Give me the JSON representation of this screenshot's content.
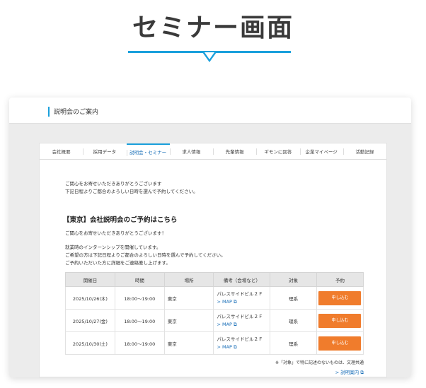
{
  "hero": {
    "title": "セミナー画面"
  },
  "window": {
    "title": "説明会のご案内"
  },
  "tabs": [
    {
      "label": "会社概要"
    },
    {
      "label": "採用データ"
    },
    {
      "label": "説明会・セミナー"
    },
    {
      "label": "求人情報"
    },
    {
      "label": "先輩情報"
    },
    {
      "label": "ギモンに回答"
    },
    {
      "label": "企業マイページ"
    },
    {
      "label": "活動記録"
    }
  ],
  "intro": {
    "line1": "ご関心をお寄せいただきありがとうございます",
    "line2": "下記日程よりご都合のよろしい日時を選んで予約してください。"
  },
  "section": {
    "title": "【東京】会社説明会のご予約はこちら",
    "para1": "ご関心をお寄せいただきありがとうございます！",
    "para2_line1": "就業時のインターンシップを開催しています。",
    "para2_line2": "ご希望の方は下記日程よりご都合のよろしい日時を選んで予約してください。",
    "para2_line3": "ご予約いただいた方に詳細をご連絡差し上げます。"
  },
  "table": {
    "headers": [
      "開催日",
      "時間",
      "場所",
      "備考（会場など）",
      "対象",
      "予約"
    ],
    "rows": [
      {
        "date": "2025/10/26(木)",
        "time": "18:00〜19:00",
        "place": "東京",
        "note": "パレスサイドビル２Ｆ",
        "map": "> MAP ⧉",
        "target": "理系",
        "button": "申し込む"
      },
      {
        "date": "2025/10/27(金)",
        "time": "18:00〜19:00",
        "place": "東京",
        "note": "パレスサイドビル２Ｆ",
        "map": "> MAP ⧉",
        "target": "理系",
        "button": "申し込む"
      },
      {
        "date": "2025/10/30(土)",
        "time": "18:00〜19:00",
        "place": "東京",
        "note": "パレスサイドビル２Ｆ",
        "map": "> MAP ⧉",
        "target": "理系",
        "button": "申し込む"
      }
    ]
  },
  "footer": {
    "footnote": "※「対象」で特に記述のないものは、文理共通",
    "guide_link": "> 説明案内 ⧉"
  },
  "colors": {
    "accent": "#1aa0dc",
    "button": "#f07c2c",
    "link": "#1a6fb8"
  }
}
